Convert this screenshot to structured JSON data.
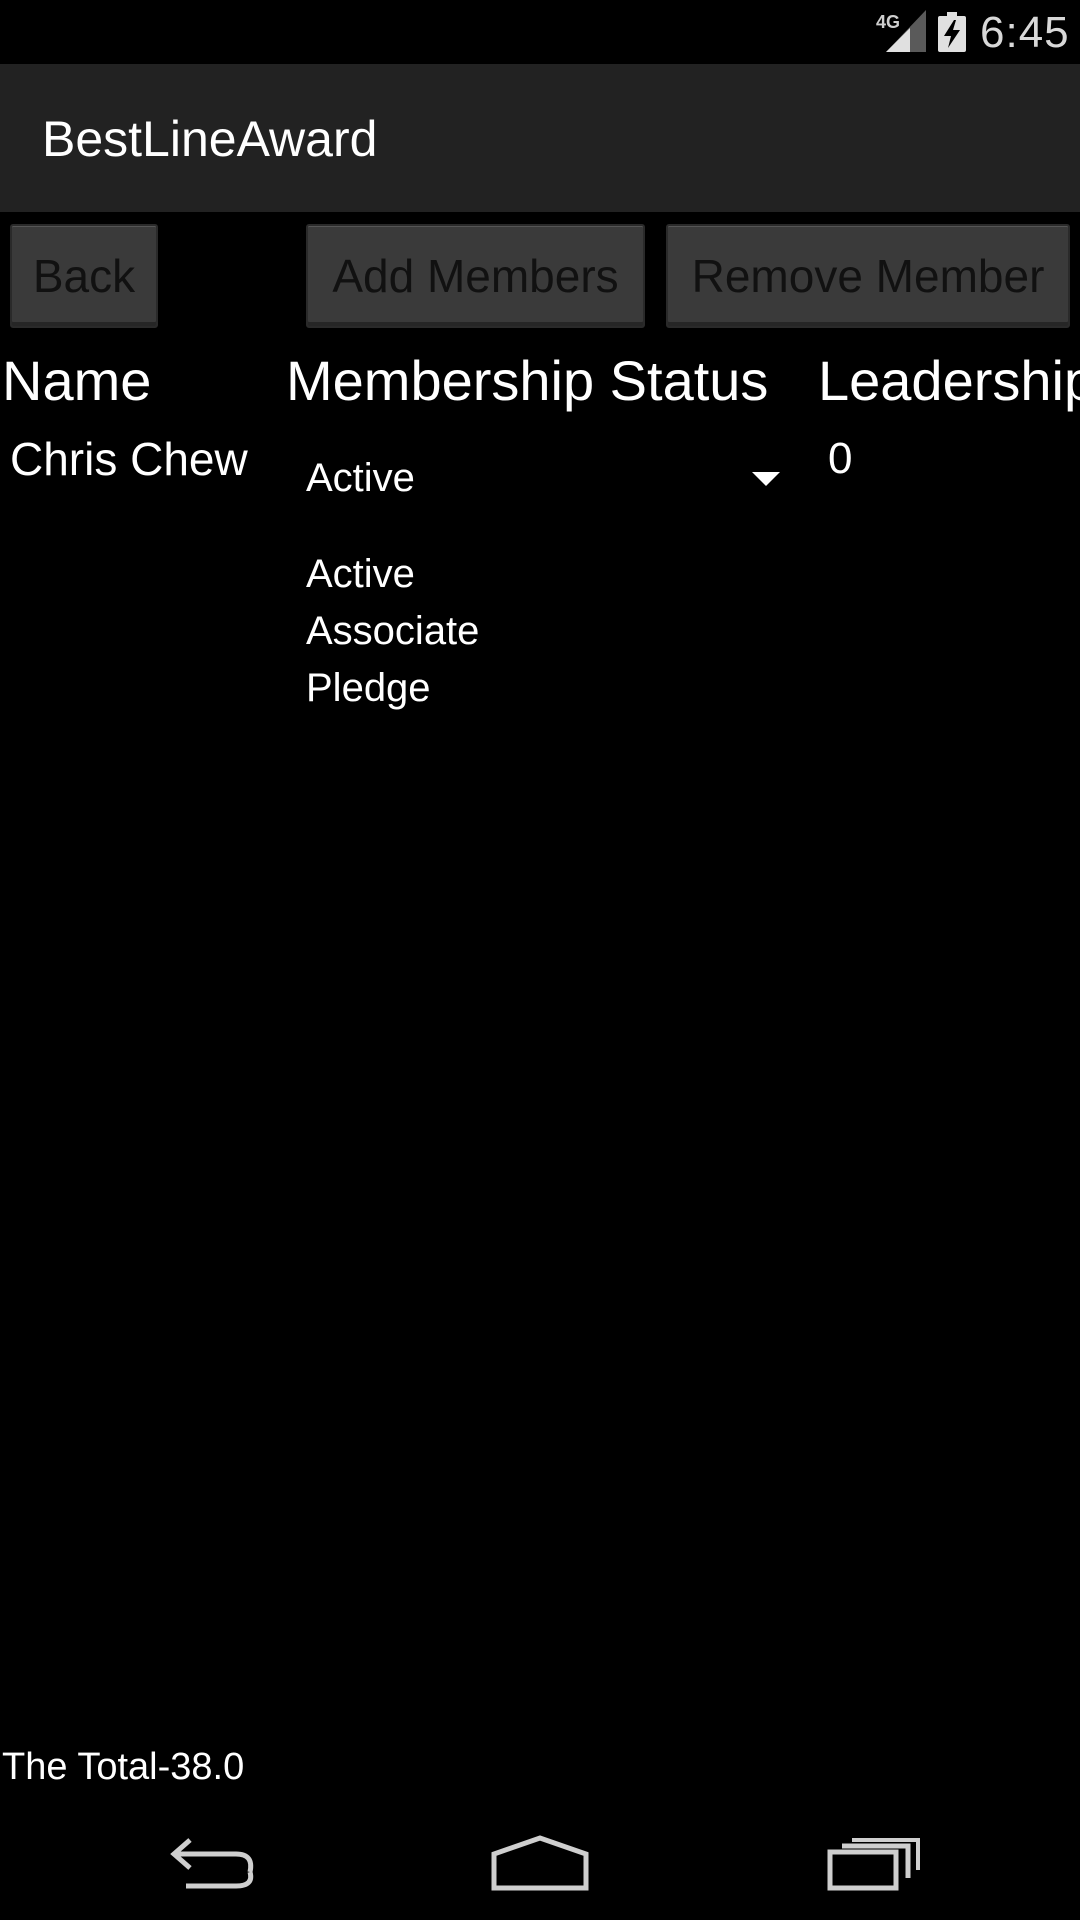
{
  "status_bar": {
    "network": "4G",
    "time": "6:45"
  },
  "app": {
    "title": "BestLineAward"
  },
  "buttons": {
    "back": "Back",
    "add_members": "Add Members",
    "remove_member": "Remove Member"
  },
  "table": {
    "headers": {
      "name": "Name",
      "status": "Membership Status",
      "leadership": "Leadership"
    },
    "row": {
      "name": "Chris Chew",
      "status": "Active",
      "leadership": "0"
    }
  },
  "status_options": [
    "Active",
    "Associate",
    "Pledge"
  ],
  "footer": {
    "total": "The Total-38.0"
  },
  "icons": {
    "signal": "signal-icon",
    "battery": "battery-charging-icon",
    "nav_back": "back-icon",
    "nav_home": "home-icon",
    "nav_recent": "recent-apps-icon"
  }
}
